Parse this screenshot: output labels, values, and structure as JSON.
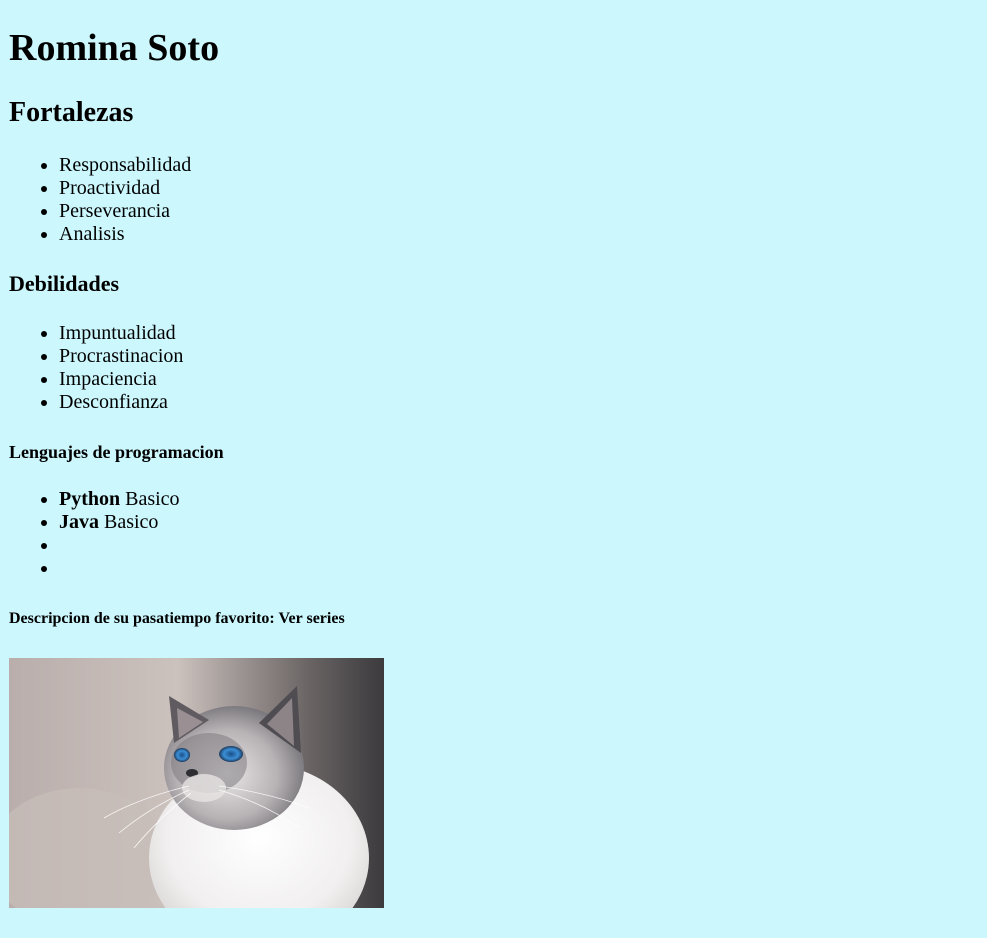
{
  "name": "Romina Soto",
  "strengths": {
    "heading": "Fortalezas",
    "items": [
      "Responsabilidad",
      "Proactividad",
      "Perseverancia",
      "Analisis"
    ]
  },
  "weaknesses": {
    "heading": "Debilidades",
    "items": [
      "Impuntualidad",
      "Procrastinacion",
      "Impaciencia",
      "Desconfianza"
    ]
  },
  "languages": {
    "heading": "Lenguajes de programacion",
    "items": [
      {
        "name": "Python",
        "level": "Basico"
      },
      {
        "name": "Java",
        "level": "Basico"
      },
      {
        "name": "",
        "level": ""
      },
      {
        "name": "",
        "level": ""
      }
    ]
  },
  "hobby": {
    "text": "Descripcion de su pasatiempo favorito: Ver series"
  },
  "colors": {
    "background": "#cbf7fd",
    "text": "#000000"
  },
  "image": {
    "subject": "cat-photo"
  }
}
